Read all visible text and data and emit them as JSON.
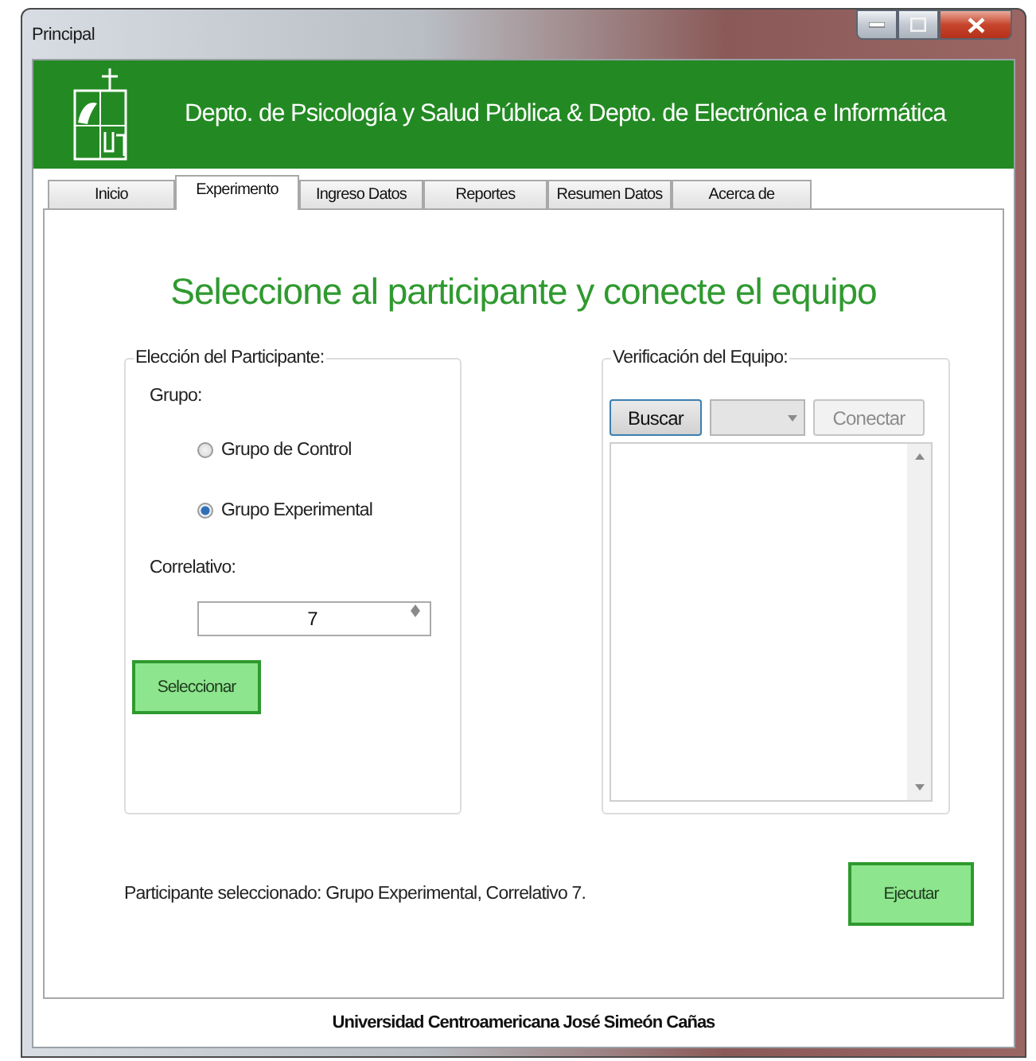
{
  "window": {
    "title": "Principal"
  },
  "header": {
    "title": "Depto. de Psicología y Salud Pública & Depto. de Electrónica e Informática"
  },
  "tabs": [
    {
      "label": "Inicio",
      "selected": false
    },
    {
      "label": "Experimento",
      "selected": true
    },
    {
      "label": "Ingreso Datos",
      "selected": false
    },
    {
      "label": "Reportes",
      "selected": false
    },
    {
      "label": "Resumen Datos",
      "selected": false
    },
    {
      "label": "Acerca de",
      "selected": false
    }
  ],
  "heading": "Seleccione al participante y conecte el equipo",
  "participant_group": {
    "title": "Elección del Participante:",
    "group_label": "Grupo:",
    "options": [
      {
        "label": "Grupo de Control",
        "selected": false
      },
      {
        "label": "Grupo Experimental",
        "selected": true
      }
    ],
    "correlativo_label": "Correlativo:",
    "correlativo_value": "7",
    "select_button": "Seleccionar"
  },
  "equipment_group": {
    "title": "Verificación del Equipo:",
    "search_button": "Buscar",
    "port_dropdown": {
      "disabled": true
    },
    "connect_button": {
      "label": "Conectar",
      "disabled": true
    }
  },
  "status_text": "Participante seleccionado: Grupo Experimental, Correlativo 7.",
  "run_button": "Ejecutar",
  "footer": "Universidad Centroamericana José Simeón Cañas"
}
